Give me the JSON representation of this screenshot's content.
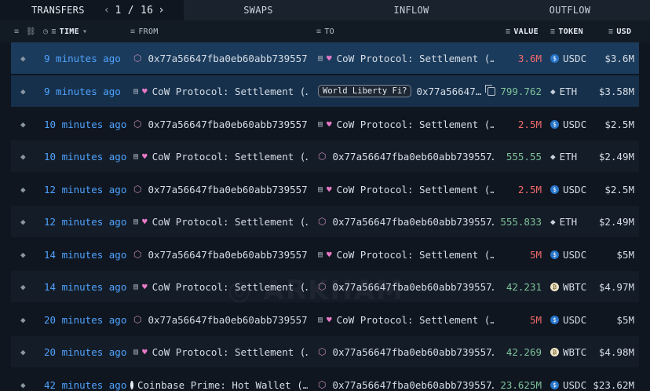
{
  "tabs": {
    "transfers": "TRANSFERS",
    "page": "1 / 16",
    "prev_icon": "chevron-left-icon",
    "next_icon": "chevron-right-icon",
    "swaps": "SWAPS",
    "inflow": "INFLOW",
    "outflow": "OUTFLOW"
  },
  "header": {
    "time": "TIME",
    "from": "FROM",
    "to": "TO",
    "value": "VALUE",
    "token": "TOKEN",
    "usd": "USD"
  },
  "rows": [
    {
      "time": "9 minutes ago",
      "from": "0x77a56647fba0eb60abb739557…",
      "to": "CoW Protocol: Settlement (…",
      "value": "3.6M",
      "token": "USDC",
      "usd": "$3.6M"
    },
    {
      "time": "9 minutes ago",
      "from": "CoW Protocol: Settlement (…",
      "to_badge": "World Liberty Fi?",
      "to": "0x77a56647…",
      "value": "799.762",
      "token": "ETH",
      "usd": "$3.58M"
    },
    {
      "time": "10 minutes ago",
      "from": "0x77a56647fba0eb60abb739557…",
      "to": "CoW Protocol: Settlement (…",
      "value": "2.5M",
      "token": "USDC",
      "usd": "$2.5M"
    },
    {
      "time": "10 minutes ago",
      "from": "CoW Protocol: Settlement (…",
      "to": "0x77a56647fba0eb60abb739557…",
      "value": "555.55",
      "token": "ETH",
      "usd": "$2.49M"
    },
    {
      "time": "12 minutes ago",
      "from": "0x77a56647fba0eb60abb739557…",
      "to": "CoW Protocol: Settlement (…",
      "value": "2.5M",
      "token": "USDC",
      "usd": "$2.5M"
    },
    {
      "time": "12 minutes ago",
      "from": "CoW Protocol: Settlement (…",
      "to": "0x77a56647fba0eb60abb739557…",
      "value": "555.833",
      "token": "ETH",
      "usd": "$2.49M"
    },
    {
      "time": "14 minutes ago",
      "from": "0x77a56647fba0eb60abb739557…",
      "to": "CoW Protocol: Settlement (…",
      "value": "5M",
      "token": "USDC",
      "usd": "$5M"
    },
    {
      "time": "14 minutes ago",
      "from": "CoW Protocol: Settlement (…",
      "to": "0x77a56647fba0eb60abb739557…",
      "value": "42.231",
      "token": "WBTC",
      "usd": "$4.97M"
    },
    {
      "time": "20 minutes ago",
      "from": "0x77a56647fba0eb60abb739557…",
      "to": "CoW Protocol: Settlement (…",
      "value": "5M",
      "token": "USDC",
      "usd": "$5M"
    },
    {
      "time": "20 minutes ago",
      "from": "CoW Protocol: Settlement (…",
      "to": "0x77a56647fba0eb60abb739557…",
      "value": "42.269",
      "token": "WBTC",
      "usd": "$4.98M"
    },
    {
      "time": "42 minutes ago",
      "from": "Coinbase Prime: Hot Wallet (…",
      "to": "0x77a56647fba0eb60abb739557…",
      "value": "23.625M",
      "token": "USDC",
      "usd": "$23.62M"
    }
  ],
  "colors": {
    "time": "#4fa3ff",
    "value_out": "#f06a6a",
    "value_in": "#7ec29a",
    "highlight": "#1b3b5c"
  }
}
